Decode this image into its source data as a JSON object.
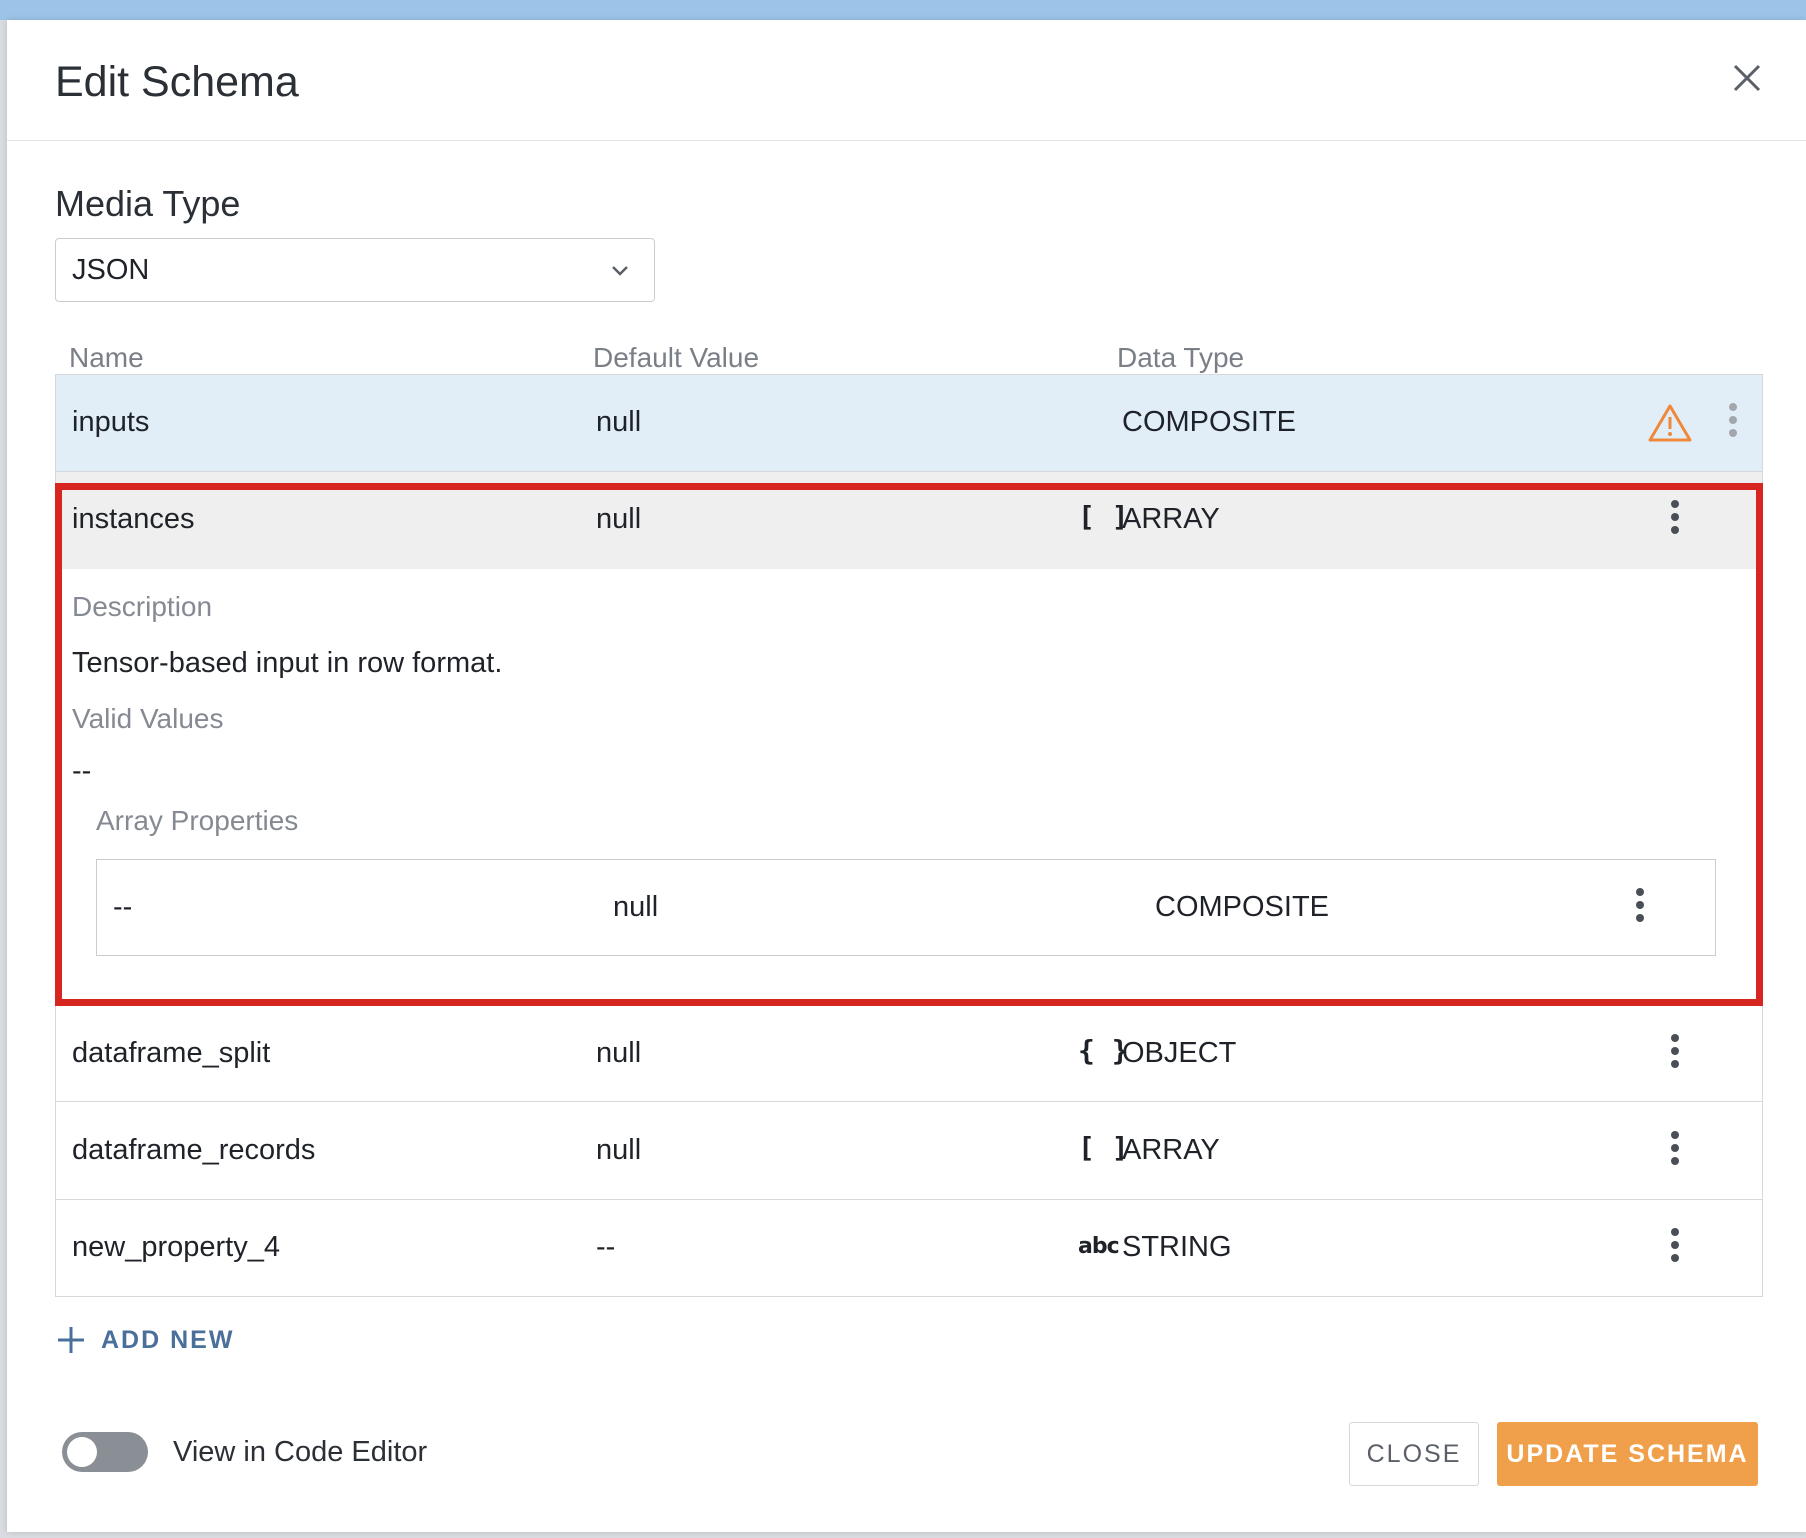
{
  "dialog": {
    "title": "Edit Schema",
    "close_icon": "close-icon"
  },
  "media_type": {
    "label": "Media Type",
    "selected": "JSON"
  },
  "columns": {
    "name": "Name",
    "default_value": "Default Value",
    "data_type": "Data Type"
  },
  "rows": [
    {
      "name": "inputs",
      "default": "null",
      "type": "COMPOSITE",
      "type_icon": "",
      "warning": true
    },
    {
      "name": "instances",
      "default": "null",
      "type": "ARRAY",
      "type_icon": "[ ]"
    },
    {
      "name": "dataframe_split",
      "default": "null",
      "type": "OBJECT",
      "type_icon": "{ }"
    },
    {
      "name": "dataframe_records",
      "default": "null",
      "type": "ARRAY",
      "type_icon": "[ ]"
    },
    {
      "name": "new_property_4",
      "default": "--",
      "type": "STRING",
      "type_icon": "abc"
    }
  ],
  "expanded": {
    "description_label": "Description",
    "description": "Tensor-based input in row format.",
    "valid_values_label": "Valid Values",
    "valid_values": "--",
    "array_properties_label": "Array Properties",
    "array_item": {
      "name": "--",
      "default": "null",
      "type": "COMPOSITE"
    }
  },
  "add_new_label": "ADD NEW",
  "code_editor_label": "View in Code Editor",
  "buttons": {
    "close": "CLOSE",
    "update": "UPDATE SCHEMA"
  },
  "colors": {
    "accent": "#f0a04b",
    "highlight": "#d7261f",
    "selected_row": "#e1eef8",
    "hover_row": "#efeff0",
    "link": "#4a6f9a"
  }
}
